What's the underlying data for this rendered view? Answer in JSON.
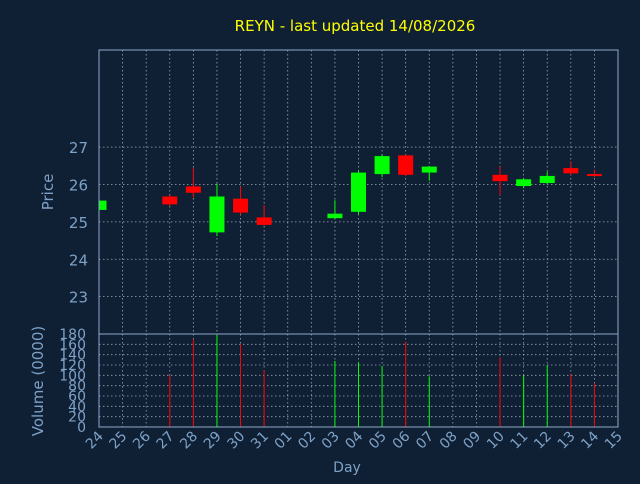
{
  "chart_data": [
    {
      "type": "candlestick",
      "title": "REYN - last updated 14/08/2026",
      "ylabel": "Price",
      "xlabel": "Day",
      "ylim": [
        22,
        29.6
      ],
      "yticks": [
        23,
        24,
        25,
        26,
        27
      ],
      "grid": true,
      "x_tick_labels": [
        "24",
        "25",
        "26",
        "27",
        "28",
        "29",
        "30",
        "31",
        "01",
        "02",
        "03",
        "04",
        "05",
        "06",
        "07",
        "08",
        "09",
        "10",
        "11",
        "12",
        "13",
        "14",
        "15"
      ],
      "candles": [
        {
          "x": "24",
          "open": 25.32,
          "close": 25.57,
          "high": 25.57,
          "low": 25.32
        },
        {
          "x": "27",
          "open": 25.68,
          "close": 25.47,
          "high": 25.72,
          "low": 25.42
        },
        {
          "x": "28",
          "open": 25.95,
          "close": 25.78,
          "high": 26.45,
          "low": 25.65
        },
        {
          "x": "29",
          "open": 24.72,
          "close": 25.68,
          "high": 26.02,
          "low": 24.62
        },
        {
          "x": "30",
          "open": 25.62,
          "close": 25.25,
          "high": 25.95,
          "low": 25.2
        },
        {
          "x": "31",
          "open": 25.12,
          "close": 24.92,
          "high": 25.45,
          "low": 24.9
        },
        {
          "x": "03",
          "open": 25.1,
          "close": 25.22,
          "high": 25.58,
          "low": 25.08
        },
        {
          "x": "04",
          "open": 25.27,
          "close": 26.32,
          "high": 26.38,
          "low": 25.2
        },
        {
          "x": "05",
          "open": 26.28,
          "close": 26.76,
          "high": 26.8,
          "low": 26.2
        },
        {
          "x": "06",
          "open": 26.78,
          "close": 26.26,
          "high": 26.8,
          "low": 26.22
        },
        {
          "x": "07",
          "open": 26.32,
          "close": 26.48,
          "high": 26.5,
          "low": 26.1
        },
        {
          "x": "10",
          "open": 26.26,
          "close": 26.09,
          "high": 26.48,
          "low": 25.72
        },
        {
          "x": "11",
          "open": 25.96,
          "close": 26.14,
          "high": 26.18,
          "low": 25.9
        },
        {
          "x": "12",
          "open": 26.04,
          "close": 26.23,
          "high": 26.34,
          "low": 26.0
        },
        {
          "x": "13",
          "open": 26.44,
          "close": 26.3,
          "high": 26.62,
          "low": 26.26
        },
        {
          "x": "14",
          "open": 26.28,
          "close": 26.25,
          "high": 26.4,
          "low": 26.2
        }
      ]
    },
    {
      "type": "bar",
      "ylabel": "Volume (0000)",
      "xlabel": "Day",
      "ylim": [
        0,
        180
      ],
      "yticks": [
        0,
        20,
        40,
        60,
        80,
        100,
        120,
        140,
        160,
        180
      ],
      "grid": true,
      "categories": [
        "27",
        "28",
        "29",
        "30",
        "31",
        "03",
        "04",
        "05",
        "06",
        "07",
        "10",
        "11",
        "12",
        "13",
        "14"
      ],
      "values": [
        100,
        170,
        178,
        160,
        110,
        128,
        125,
        118,
        165,
        98,
        135,
        100,
        120,
        102,
        85
      ]
    }
  ],
  "colors": {
    "background": "#0f2035",
    "plot_border": "#8fa9c9",
    "grid": "#cfd8e6",
    "title": "#ffff00",
    "axis_text": "#7ea1c6",
    "up": "#00ff00",
    "down": "#ff0000"
  }
}
